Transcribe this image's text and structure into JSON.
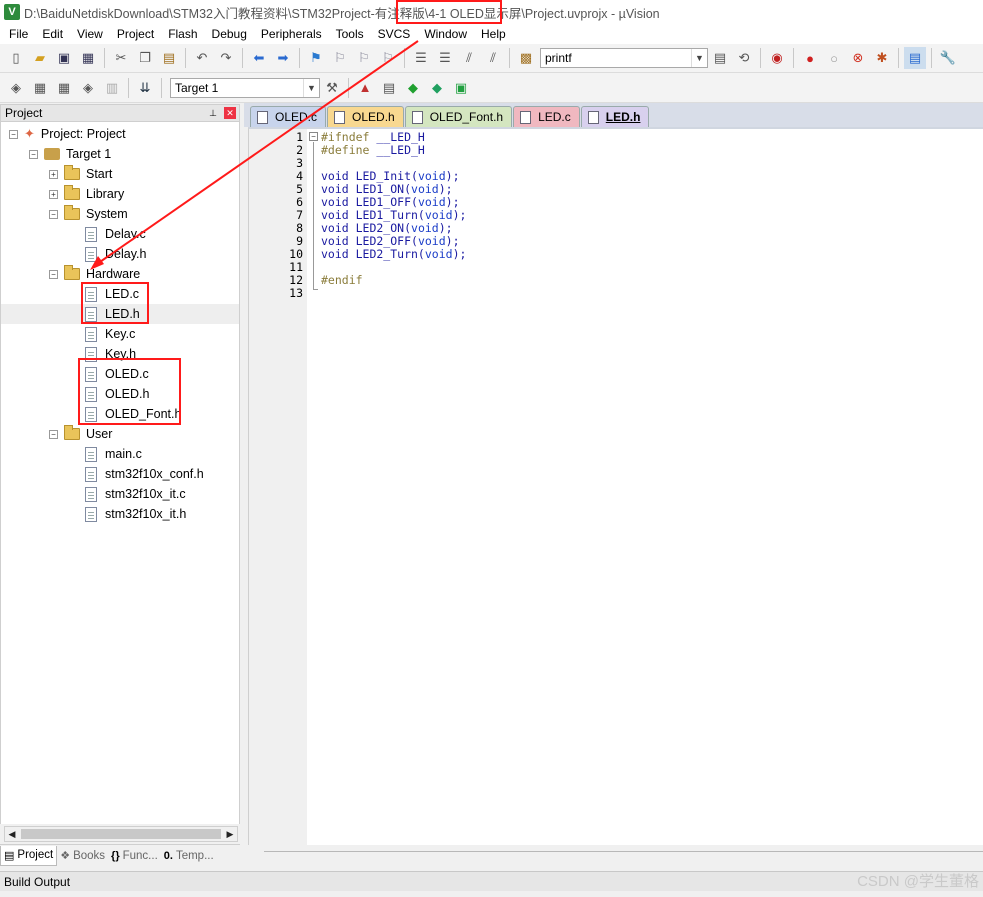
{
  "window": {
    "title": "D:\\BaiduNetdiskDownload\\STM32入门教程资料\\STM32Project-有注释版\\4-1 OLED显示屏\\Project.uvprojx - µVision",
    "app_icon_glyph": "V"
  },
  "menu": [
    "File",
    "Edit",
    "View",
    "Project",
    "Flash",
    "Debug",
    "Peripherals",
    "Tools",
    "SVCS",
    "Window",
    "Help"
  ],
  "toolbar": {
    "find_value": "printf",
    "target_value": "Target 1"
  },
  "project_panel": {
    "title": "Project",
    "tree": {
      "root": "Project: Project",
      "target": "Target 1",
      "groups": {
        "start": "Start",
        "library": "Library",
        "system": "System",
        "hardware": "Hardware",
        "user": "User"
      },
      "files": {
        "delay_c": "Delay.c",
        "delay_h": "Delay.h",
        "led_c": "LED.c",
        "led_h": "LED.h",
        "key_c": "Key.c",
        "key_h": "Key.h",
        "oled_c": "OLED.c",
        "oled_h": "OLED.h",
        "oled_font_h": "OLED_Font.h",
        "main_c": "main.c",
        "conf_h": "stm32f10x_conf.h",
        "it_c": "stm32f10x_it.c",
        "it_h": "stm32f10x_it.h"
      }
    },
    "bottom_tabs": [
      "Project",
      "Books",
      "Func...",
      "Temp..."
    ]
  },
  "editor": {
    "tabs": [
      {
        "label": "OLED.c",
        "color": "#c8d4ec"
      },
      {
        "label": "OLED.h",
        "color": "#f8d890"
      },
      {
        "label": "OLED_Font.h",
        "color": "#d4e6c0"
      },
      {
        "label": "LED.c",
        "color": "#f0b8c0"
      },
      {
        "label": "LED.h",
        "color": "#d8d0ee"
      }
    ],
    "active_tab": "LED.h",
    "line_numbers": [
      "1",
      "2",
      "3",
      "4",
      "5",
      "6",
      "7",
      "8",
      "9",
      "10",
      "11",
      "12",
      "13"
    ],
    "lines": {
      "l1_pp": "#ifndef",
      "l1_rest": " __LED_H",
      "l2_pp": "#define",
      "l2_rest": " __LED_H",
      "l4_fn": "void LED_Init(",
      "l4_kw": "void",
      "l4_end": ");",
      "l5_fn": "void LED1_ON(",
      "l5_kw": "void",
      "l5_end": ");",
      "l6_fn": "void LED1_OFF(",
      "l6_kw": "void",
      "l6_end": ");",
      "l7_fn": "void LED1_Turn(",
      "l7_kw": "void",
      "l7_end": ");",
      "l8_fn": "void LED2_ON(",
      "l8_kw": "void",
      "l8_end": ");",
      "l9_fn": "void LED2_OFF(",
      "l9_kw": "void",
      "l9_end": ");",
      "l10_fn": "void LED2_Turn(",
      "l10_kw": "void",
      "l10_end": ");",
      "l12_pp": "#endif"
    },
    "colors": {
      "preprocessor": "#8a7c3a",
      "keyword": "#1a3cc8",
      "text": "#1a1aa0"
    }
  },
  "build_output": {
    "title": "Build Output"
  },
  "watermark": "CSDN @学生董格",
  "annotation": {
    "color": "#ff1a1a"
  }
}
